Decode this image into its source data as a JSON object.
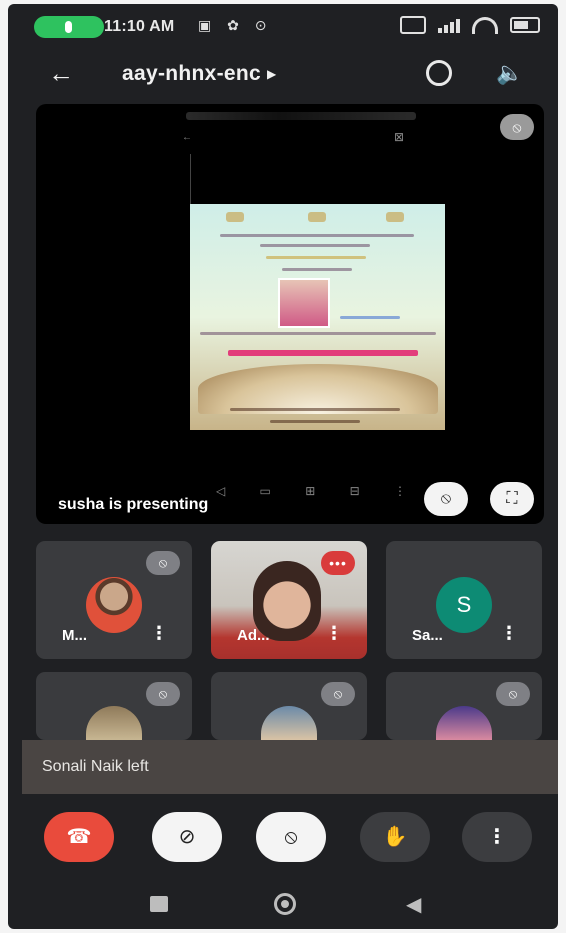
{
  "status_bar": {
    "time": "11:10 AM"
  },
  "top_bar": {
    "meeting_code": "aay-nhnx-enc"
  },
  "presentation": {
    "presenter_text": "susha is presenting"
  },
  "participants": [
    {
      "name": "M...",
      "avatar": "photo",
      "muted": true
    },
    {
      "name": "Ad...",
      "avatar": "video",
      "muted": false,
      "speaking": true
    },
    {
      "name": "Sa...",
      "avatar_letter": "S",
      "muted": true
    },
    {
      "name": "",
      "avatar": "photo",
      "muted": true
    },
    {
      "name": "",
      "avatar": "photo",
      "muted": true
    },
    {
      "name": "",
      "avatar": "photo",
      "muted": true
    }
  ],
  "toast": {
    "message": "Sonali Naik left"
  },
  "colors": {
    "background": "#1f2023",
    "tile": "#3a3b3e",
    "end_call": "#e94b3c",
    "status_pill": "#2ec25f",
    "avatar_s": "#0d8b74",
    "speaking_badge": "#d93b3b"
  },
  "icons": {
    "back": "back-arrow-icon",
    "switch_camera": "switch-camera-icon",
    "speaker": "speaker-icon",
    "end_call": "phone-hangup-icon",
    "camera_off": "camera-off-icon",
    "mic_off": "mic-off-icon",
    "raise_hand": "hand-icon",
    "more": "more-vert-icon",
    "fullscreen": "fullscreen-icon"
  }
}
